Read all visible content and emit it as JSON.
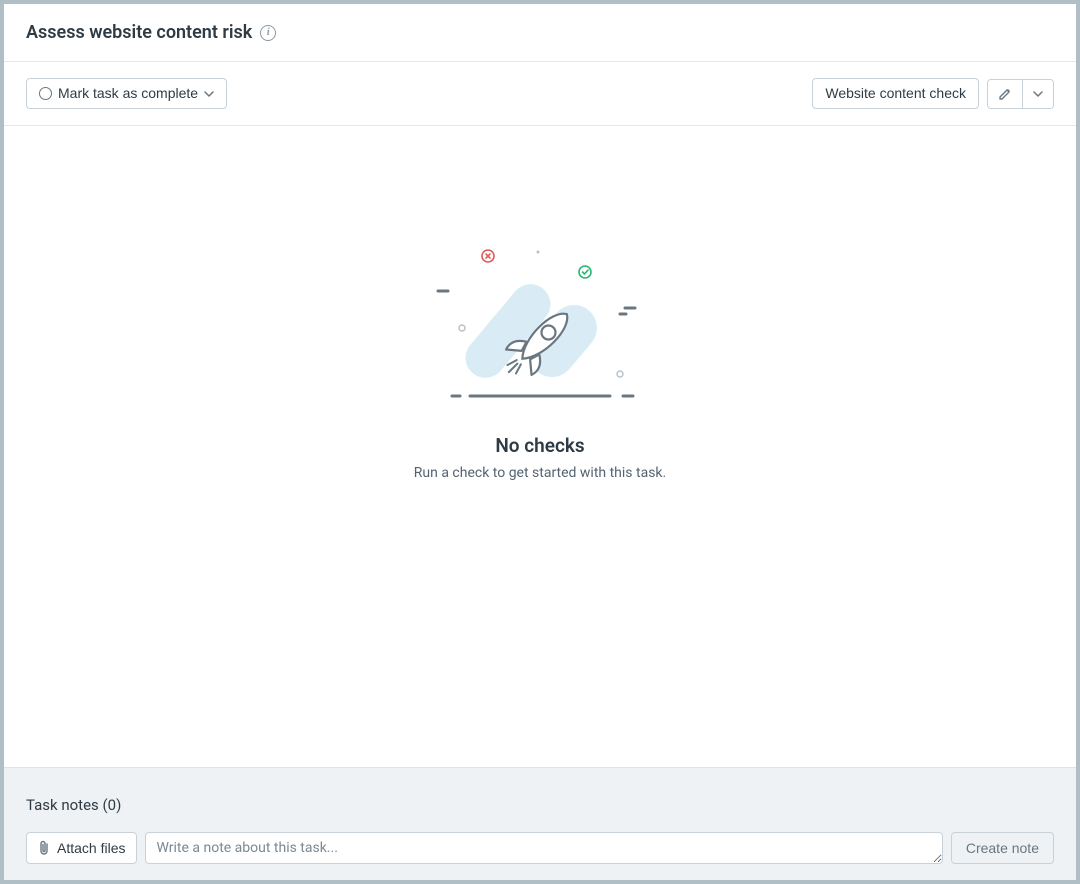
{
  "header": {
    "title": "Assess website content risk"
  },
  "toolbar": {
    "mark_complete_label": "Mark task as complete",
    "check_label": "Website content check"
  },
  "empty_state": {
    "title": "No checks",
    "subtitle": "Run a check to get started with this task."
  },
  "notes": {
    "title": "Task notes (0)",
    "attach_label": "Attach files",
    "input_placeholder": "Write a note about this task...",
    "create_label": "Create note"
  },
  "colors": {
    "text_primary": "#2f3b44",
    "text_secondary": "#546371",
    "border": "#c9d1d8",
    "panel_bg": "#eef2f5",
    "accent_green": "#2bb673",
    "accent_red": "#e05b5b",
    "illustration_blue": "#d9ecf6",
    "illustration_stroke": "#6a7781"
  }
}
